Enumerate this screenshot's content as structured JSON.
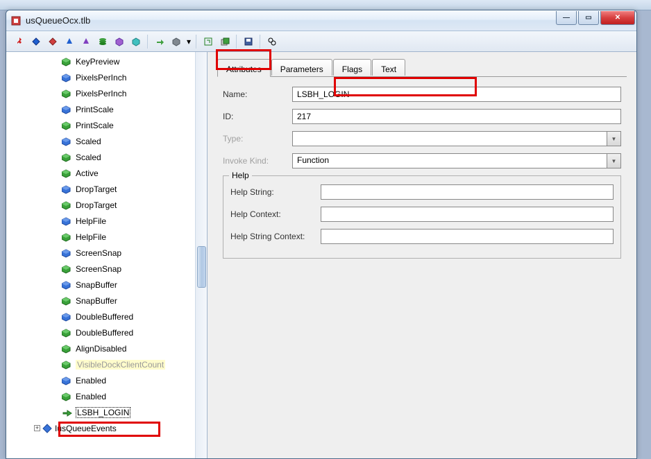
{
  "window": {
    "title": "usQueueOcx.tlb"
  },
  "tree": {
    "items": [
      {
        "label": "KeyPreview",
        "icon": "prop-green"
      },
      {
        "label": "PixelsPerInch",
        "icon": "prop-blue"
      },
      {
        "label": "PixelsPerInch",
        "icon": "prop-green"
      },
      {
        "label": "PrintScale",
        "icon": "prop-blue"
      },
      {
        "label": "PrintScale",
        "icon": "prop-green"
      },
      {
        "label": "Scaled",
        "icon": "prop-blue"
      },
      {
        "label": "Scaled",
        "icon": "prop-green"
      },
      {
        "label": "Active",
        "icon": "prop-green"
      },
      {
        "label": "DropTarget",
        "icon": "prop-blue"
      },
      {
        "label": "DropTarget",
        "icon": "prop-green"
      },
      {
        "label": "HelpFile",
        "icon": "prop-blue"
      },
      {
        "label": "HelpFile",
        "icon": "prop-green"
      },
      {
        "label": "ScreenSnap",
        "icon": "prop-blue"
      },
      {
        "label": "ScreenSnap",
        "icon": "prop-green"
      },
      {
        "label": "SnapBuffer",
        "icon": "prop-blue"
      },
      {
        "label": "SnapBuffer",
        "icon": "prop-green"
      },
      {
        "label": "DoubleBuffered",
        "icon": "prop-blue"
      },
      {
        "label": "DoubleBuffered",
        "icon": "prop-green"
      },
      {
        "label": "AlignDisabled",
        "icon": "prop-green"
      },
      {
        "label": "VisibleDockClientCount",
        "icon": "prop-green",
        "special": true
      },
      {
        "label": "Enabled",
        "icon": "prop-blue"
      },
      {
        "label": "Enabled",
        "icon": "prop-green"
      },
      {
        "label": "LSBH_LOGIN",
        "icon": "method-green",
        "selected": true
      }
    ],
    "parent": {
      "label": "IusQueueEvents",
      "icon": "interface-blue",
      "expand": "+"
    }
  },
  "tabs": {
    "active": "Attributes",
    "list": [
      "Attributes",
      "Parameters",
      "Flags",
      "Text"
    ]
  },
  "form": {
    "name_label": "Name:",
    "name_value": "LSBH_LOGIN",
    "id_label": "ID:",
    "id_value": "217",
    "type_label": "Type:",
    "type_value": "",
    "invoke_label": "Invoke Kind:",
    "invoke_value": "Function",
    "help_legend": "Help",
    "help_string_label": "Help String:",
    "help_string_value": "",
    "help_context_label": "Help Context:",
    "help_context_value": "",
    "help_string_context_label": "Help String Context:",
    "help_string_context_value": ""
  }
}
